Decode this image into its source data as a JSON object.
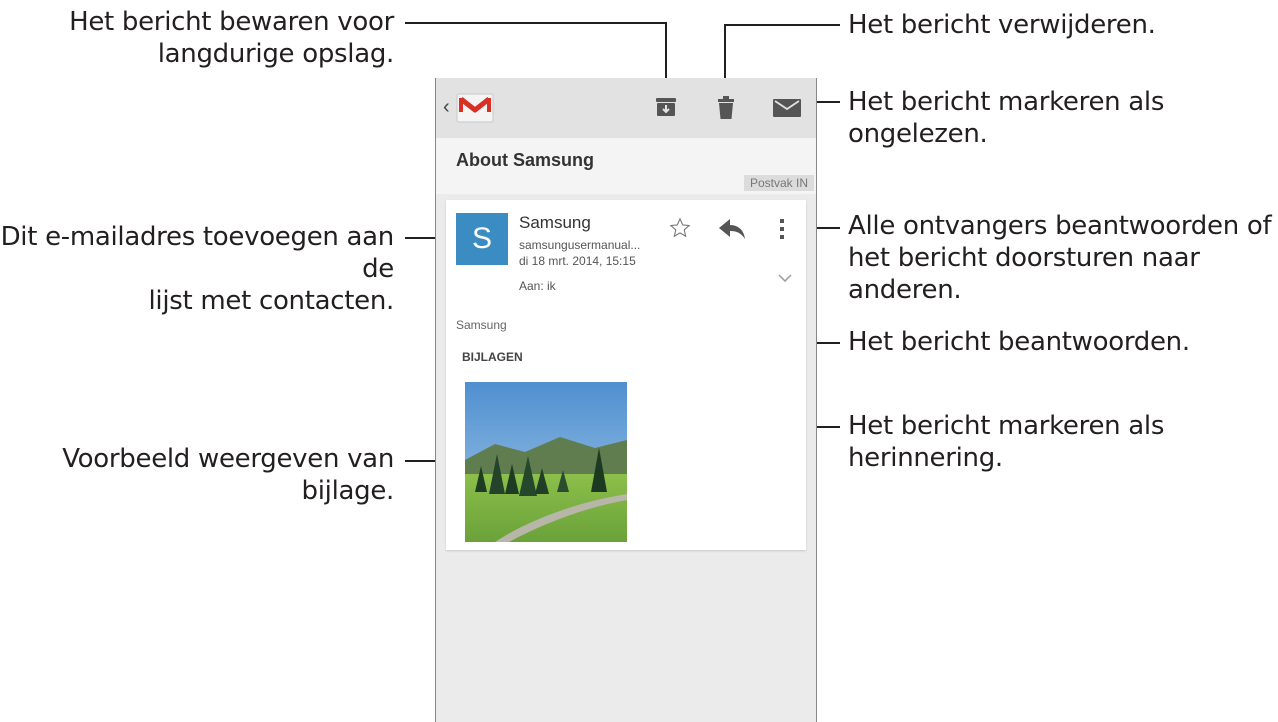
{
  "callouts": {
    "archive": [
      "Het bericht bewaren voor",
      "langdurige opslag."
    ],
    "delete": "Het bericht verwijderen.",
    "unread": "Het bericht markeren als ongelezen.",
    "add_contact": [
      "Dit e-mailadres toevoegen aan de",
      "lijst met contacten."
    ],
    "more": [
      "Alle ontvangers beantwoorden of",
      "het bericht doorsturen naar",
      "anderen."
    ],
    "reply": "Het bericht beantwoorden.",
    "star": [
      "Het bericht markeren als",
      "herinnering."
    ],
    "preview": "Voorbeeld weergeven van bijlage."
  },
  "email": {
    "subject": "About Samsung",
    "label": "Postvak IN",
    "avatar_letter": "S",
    "sender": "Samsung",
    "sender_email": "samsungusermanual...",
    "date": "di 18 mrt. 2014, 15:15",
    "to": "Aan: ik",
    "body": "Samsung",
    "attachments_title": "BIJLAGEN"
  },
  "colors": {
    "avatar": "#3a8cc3",
    "gmail_red": "#d93025",
    "icon_gray": "#555555"
  },
  "icons": [
    "back-chevron-icon",
    "gmail-icon",
    "archive-icon",
    "trash-icon",
    "mark-unread-icon",
    "star-icon",
    "reply-icon",
    "overflow-menu-icon",
    "chevron-down-icon"
  ]
}
